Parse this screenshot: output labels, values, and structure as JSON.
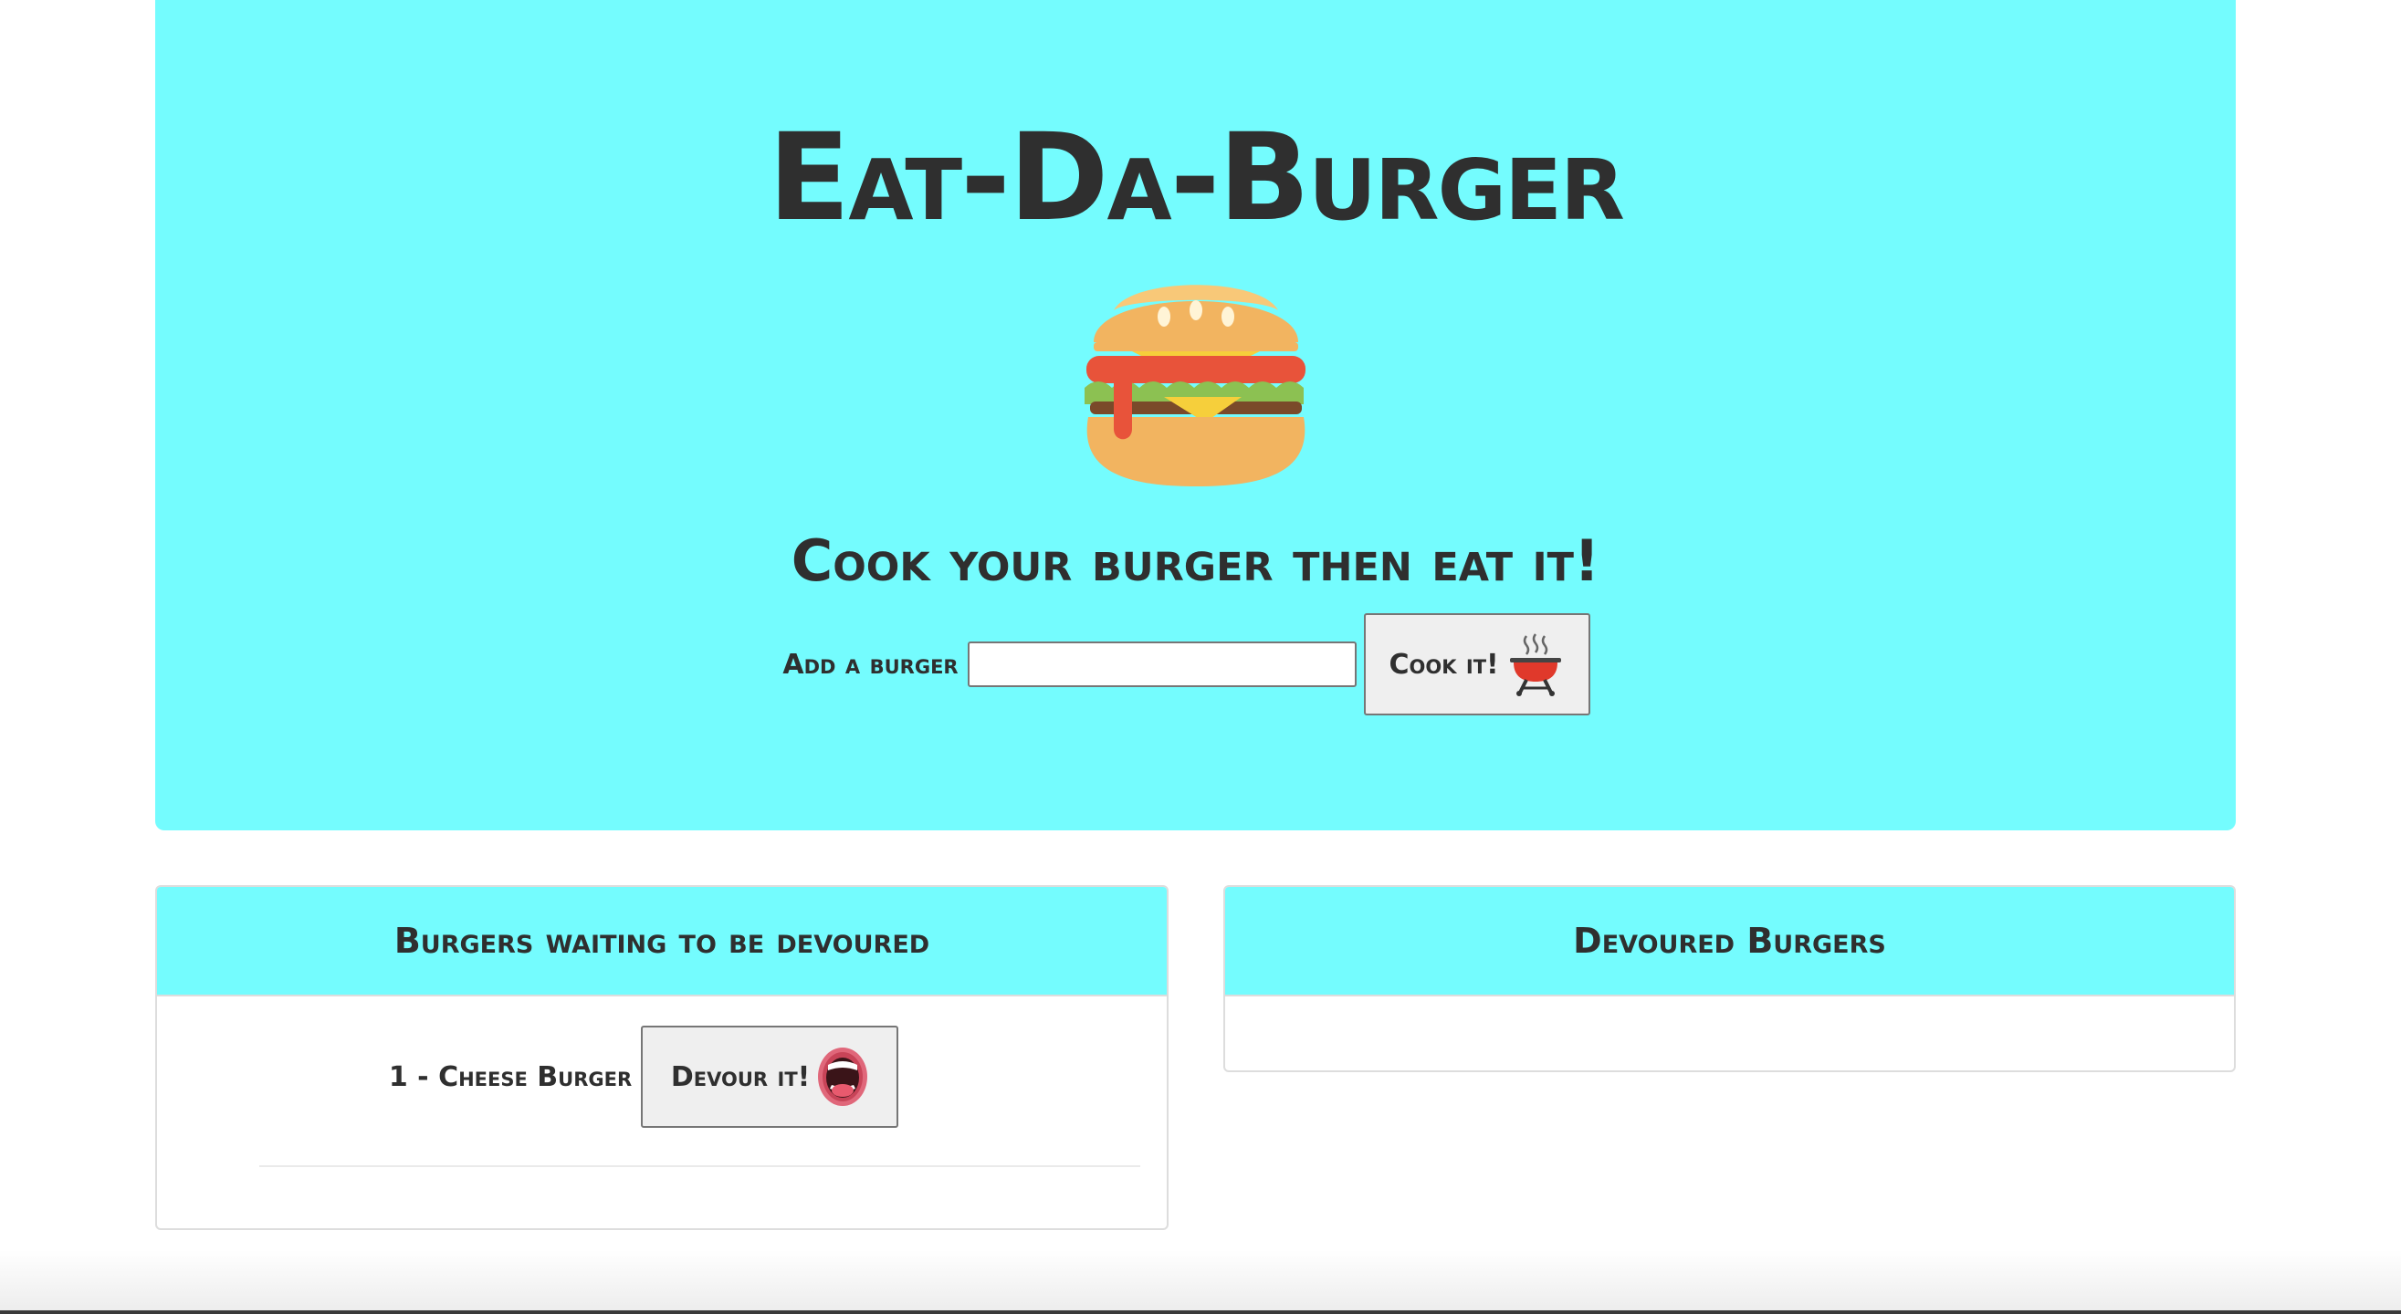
{
  "header": {
    "title": "Eat-Da-Burger",
    "subtitle": "Cook your burger then eat it!"
  },
  "add_form": {
    "label": "Add a burger",
    "input_value": "",
    "placeholder": "",
    "cook_button_label": "Cook it!"
  },
  "waiting_panel": {
    "title": "Burgers waiting to be devoured",
    "items": [
      {
        "label": "1 - Cheese Burger",
        "button_label": "Devour it!"
      }
    ]
  },
  "devoured_panel": {
    "title": "Devoured Burgers",
    "items": []
  },
  "icons": {
    "hero": "burger-icon",
    "cook": "grill-icon",
    "devour": "open-mouth-icon"
  },
  "colors": {
    "accent": "#74fcfe",
    "text": "#2f2f2f",
    "button_bg": "#efefef"
  }
}
